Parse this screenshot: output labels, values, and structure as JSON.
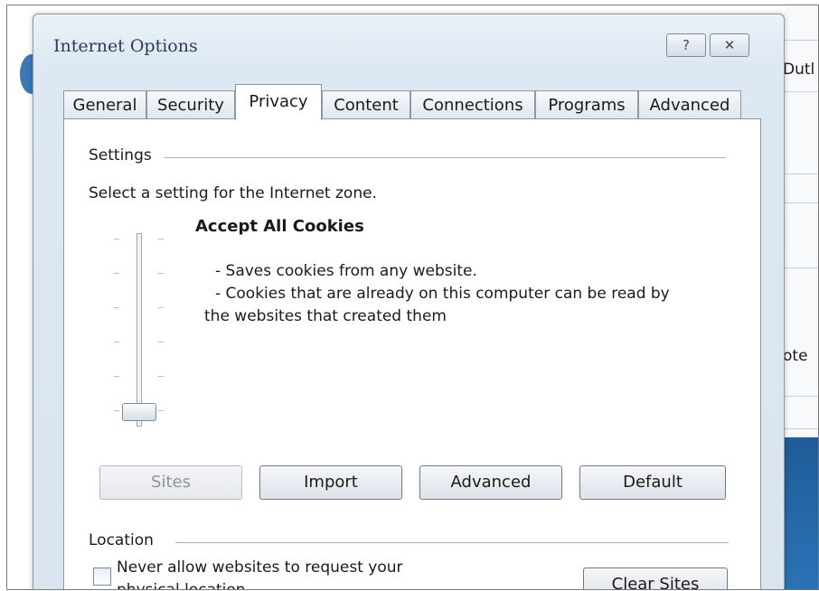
{
  "background": {
    "text_top": "Dutl",
    "text_mid": "ote"
  },
  "dialog": {
    "title": "Internet Options",
    "help_glyph": "?",
    "close_glyph": "✕",
    "tabs": [
      {
        "label": "General",
        "active": false
      },
      {
        "label": "Security",
        "active": false
      },
      {
        "label": "Privacy",
        "active": true
      },
      {
        "label": "Content",
        "active": false
      },
      {
        "label": "Connections",
        "active": false
      },
      {
        "label": "Programs",
        "active": false
      },
      {
        "label": "Advanced",
        "active": false
      }
    ]
  },
  "settings": {
    "group_label": "Settings",
    "instruction": "Select a setting for the Internet zone.",
    "level_title": "Accept All Cookies",
    "level_lines": [
      "- Saves cookies from any website.",
      "- Cookies that are already on this computer can be read by",
      "the websites that created them"
    ],
    "buttons": {
      "sites": "Sites",
      "import": "Import",
      "advanced": "Advanced",
      "default": "Default"
    }
  },
  "location": {
    "group_label": "Location",
    "checkbox_label_line1": "Never allow websites to request your",
    "checkbox_label_line2": "physical location",
    "clear_sites": "Clear Sites"
  }
}
